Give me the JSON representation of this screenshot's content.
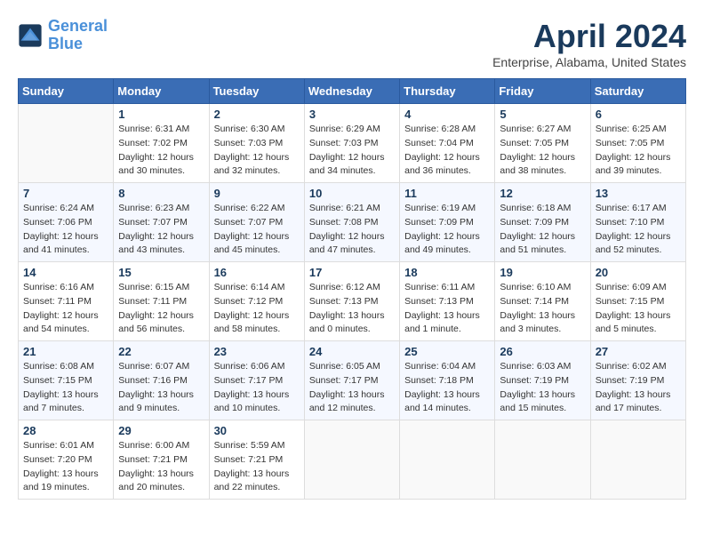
{
  "logo": {
    "line1": "General",
    "line2": "Blue"
  },
  "title": "April 2024",
  "subtitle": "Enterprise, Alabama, United States",
  "weekdays": [
    "Sunday",
    "Monday",
    "Tuesday",
    "Wednesday",
    "Thursday",
    "Friday",
    "Saturday"
  ],
  "weeks": [
    [
      {
        "day": "",
        "info": ""
      },
      {
        "day": "1",
        "info": "Sunrise: 6:31 AM\nSunset: 7:02 PM\nDaylight: 12 hours\nand 30 minutes."
      },
      {
        "day": "2",
        "info": "Sunrise: 6:30 AM\nSunset: 7:03 PM\nDaylight: 12 hours\nand 32 minutes."
      },
      {
        "day": "3",
        "info": "Sunrise: 6:29 AM\nSunset: 7:03 PM\nDaylight: 12 hours\nand 34 minutes."
      },
      {
        "day": "4",
        "info": "Sunrise: 6:28 AM\nSunset: 7:04 PM\nDaylight: 12 hours\nand 36 minutes."
      },
      {
        "day": "5",
        "info": "Sunrise: 6:27 AM\nSunset: 7:05 PM\nDaylight: 12 hours\nand 38 minutes."
      },
      {
        "day": "6",
        "info": "Sunrise: 6:25 AM\nSunset: 7:05 PM\nDaylight: 12 hours\nand 39 minutes."
      }
    ],
    [
      {
        "day": "7",
        "info": "Sunrise: 6:24 AM\nSunset: 7:06 PM\nDaylight: 12 hours\nand 41 minutes."
      },
      {
        "day": "8",
        "info": "Sunrise: 6:23 AM\nSunset: 7:07 PM\nDaylight: 12 hours\nand 43 minutes."
      },
      {
        "day": "9",
        "info": "Sunrise: 6:22 AM\nSunset: 7:07 PM\nDaylight: 12 hours\nand 45 minutes."
      },
      {
        "day": "10",
        "info": "Sunrise: 6:21 AM\nSunset: 7:08 PM\nDaylight: 12 hours\nand 47 minutes."
      },
      {
        "day": "11",
        "info": "Sunrise: 6:19 AM\nSunset: 7:09 PM\nDaylight: 12 hours\nand 49 minutes."
      },
      {
        "day": "12",
        "info": "Sunrise: 6:18 AM\nSunset: 7:09 PM\nDaylight: 12 hours\nand 51 minutes."
      },
      {
        "day": "13",
        "info": "Sunrise: 6:17 AM\nSunset: 7:10 PM\nDaylight: 12 hours\nand 52 minutes."
      }
    ],
    [
      {
        "day": "14",
        "info": "Sunrise: 6:16 AM\nSunset: 7:11 PM\nDaylight: 12 hours\nand 54 minutes."
      },
      {
        "day": "15",
        "info": "Sunrise: 6:15 AM\nSunset: 7:11 PM\nDaylight: 12 hours\nand 56 minutes."
      },
      {
        "day": "16",
        "info": "Sunrise: 6:14 AM\nSunset: 7:12 PM\nDaylight: 12 hours\nand 58 minutes."
      },
      {
        "day": "17",
        "info": "Sunrise: 6:12 AM\nSunset: 7:13 PM\nDaylight: 13 hours\nand 0 minutes."
      },
      {
        "day": "18",
        "info": "Sunrise: 6:11 AM\nSunset: 7:13 PM\nDaylight: 13 hours\nand 1 minute."
      },
      {
        "day": "19",
        "info": "Sunrise: 6:10 AM\nSunset: 7:14 PM\nDaylight: 13 hours\nand 3 minutes."
      },
      {
        "day": "20",
        "info": "Sunrise: 6:09 AM\nSunset: 7:15 PM\nDaylight: 13 hours\nand 5 minutes."
      }
    ],
    [
      {
        "day": "21",
        "info": "Sunrise: 6:08 AM\nSunset: 7:15 PM\nDaylight: 13 hours\nand 7 minutes."
      },
      {
        "day": "22",
        "info": "Sunrise: 6:07 AM\nSunset: 7:16 PM\nDaylight: 13 hours\nand 9 minutes."
      },
      {
        "day": "23",
        "info": "Sunrise: 6:06 AM\nSunset: 7:17 PM\nDaylight: 13 hours\nand 10 minutes."
      },
      {
        "day": "24",
        "info": "Sunrise: 6:05 AM\nSunset: 7:17 PM\nDaylight: 13 hours\nand 12 minutes."
      },
      {
        "day": "25",
        "info": "Sunrise: 6:04 AM\nSunset: 7:18 PM\nDaylight: 13 hours\nand 14 minutes."
      },
      {
        "day": "26",
        "info": "Sunrise: 6:03 AM\nSunset: 7:19 PM\nDaylight: 13 hours\nand 15 minutes."
      },
      {
        "day": "27",
        "info": "Sunrise: 6:02 AM\nSunset: 7:19 PM\nDaylight: 13 hours\nand 17 minutes."
      }
    ],
    [
      {
        "day": "28",
        "info": "Sunrise: 6:01 AM\nSunset: 7:20 PM\nDaylight: 13 hours\nand 19 minutes."
      },
      {
        "day": "29",
        "info": "Sunrise: 6:00 AM\nSunset: 7:21 PM\nDaylight: 13 hours\nand 20 minutes."
      },
      {
        "day": "30",
        "info": "Sunrise: 5:59 AM\nSunset: 7:21 PM\nDaylight: 13 hours\nand 22 minutes."
      },
      {
        "day": "",
        "info": ""
      },
      {
        "day": "",
        "info": ""
      },
      {
        "day": "",
        "info": ""
      },
      {
        "day": "",
        "info": ""
      }
    ]
  ]
}
